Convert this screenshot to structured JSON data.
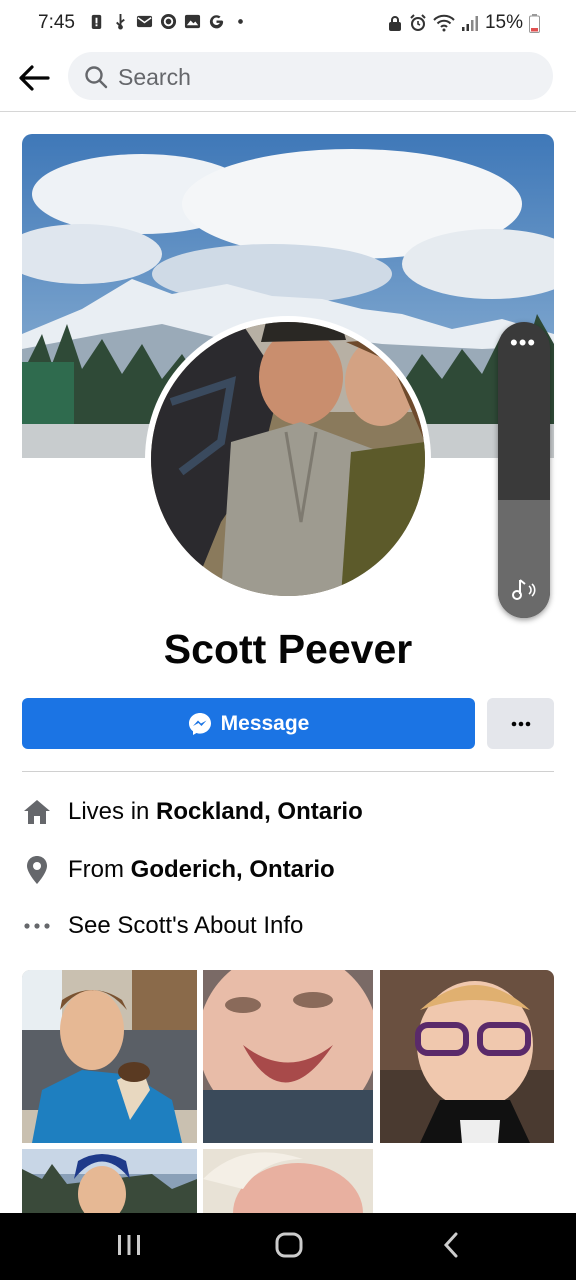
{
  "status_bar": {
    "time": "7:45",
    "left_icons": [
      "battery-alert-icon",
      "usb-icon",
      "mail-icon",
      "sync-icon",
      "gallery-icon",
      "google-icon",
      "dot-icon"
    ],
    "right_icons": [
      "lock-icon",
      "alarm-icon",
      "wifi-icon",
      "signal-icon"
    ],
    "battery": "15%"
  },
  "header": {
    "search_placeholder": "Search"
  },
  "profile": {
    "name": "Scott Peever",
    "message_label": "Message"
  },
  "info": {
    "lives_prefix": "Lives in ",
    "lives_place": "Rockland, Ontario",
    "from_prefix": "From ",
    "from_place": "Goderich, Ontario",
    "about_label": "See Scott's About Info"
  },
  "photos": [
    "boy-with-ice-cream",
    "laughing-baby",
    "baby-with-glasses",
    "child-in-hat",
    "newborn-baby"
  ],
  "volume": {
    "level": 0.4
  },
  "colors": {
    "accent": "#1b74e4",
    "secondary_button": "#e4e6eb",
    "icon_gray": "#65676b"
  }
}
